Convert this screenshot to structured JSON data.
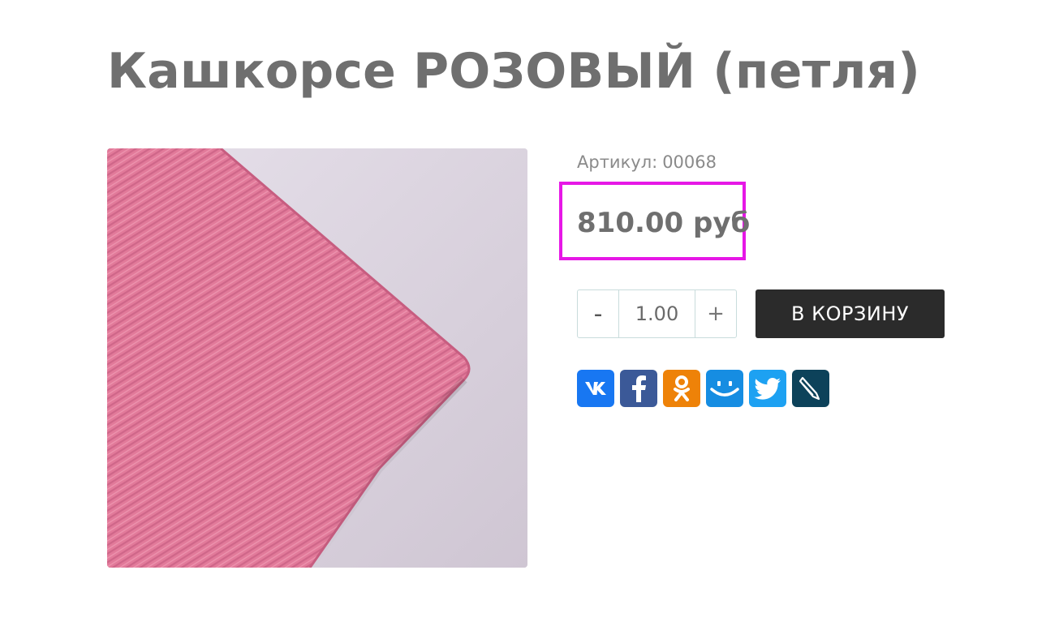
{
  "product": {
    "title": "Кашкорсе РОЗОВЫЙ (петля)",
    "image_alt": "Кашкорсе РОЗОВЫЙ (петля)",
    "sku_label": "Артикул:",
    "sku_value": "00068",
    "price": "810.00 руб"
  },
  "quantity": {
    "minus_label": "-",
    "value": "1.00",
    "plus_label": "+"
  },
  "cart_button_label": "В КОРЗИНУ",
  "share": [
    {
      "name": "vk",
      "icon": "vk-icon",
      "color": "#1877f2"
    },
    {
      "name": "facebook",
      "icon": "facebook-icon",
      "color": "#3b5998"
    },
    {
      "name": "odnoklassniki",
      "icon": "odnoklassniki-icon",
      "color": "#ee8208"
    },
    {
      "name": "moimir",
      "icon": "moimir-icon",
      "color": "#168de2"
    },
    {
      "name": "twitter",
      "icon": "twitter-icon",
      "color": "#1da1f2"
    },
    {
      "name": "livejournal",
      "icon": "livejournal-icon",
      "color": "#0d425a"
    }
  ],
  "colors": {
    "highlight": "#e617e6",
    "text": "#6f6f6f",
    "button": "#2b2b2b",
    "fabric": "#e37c9c"
  }
}
